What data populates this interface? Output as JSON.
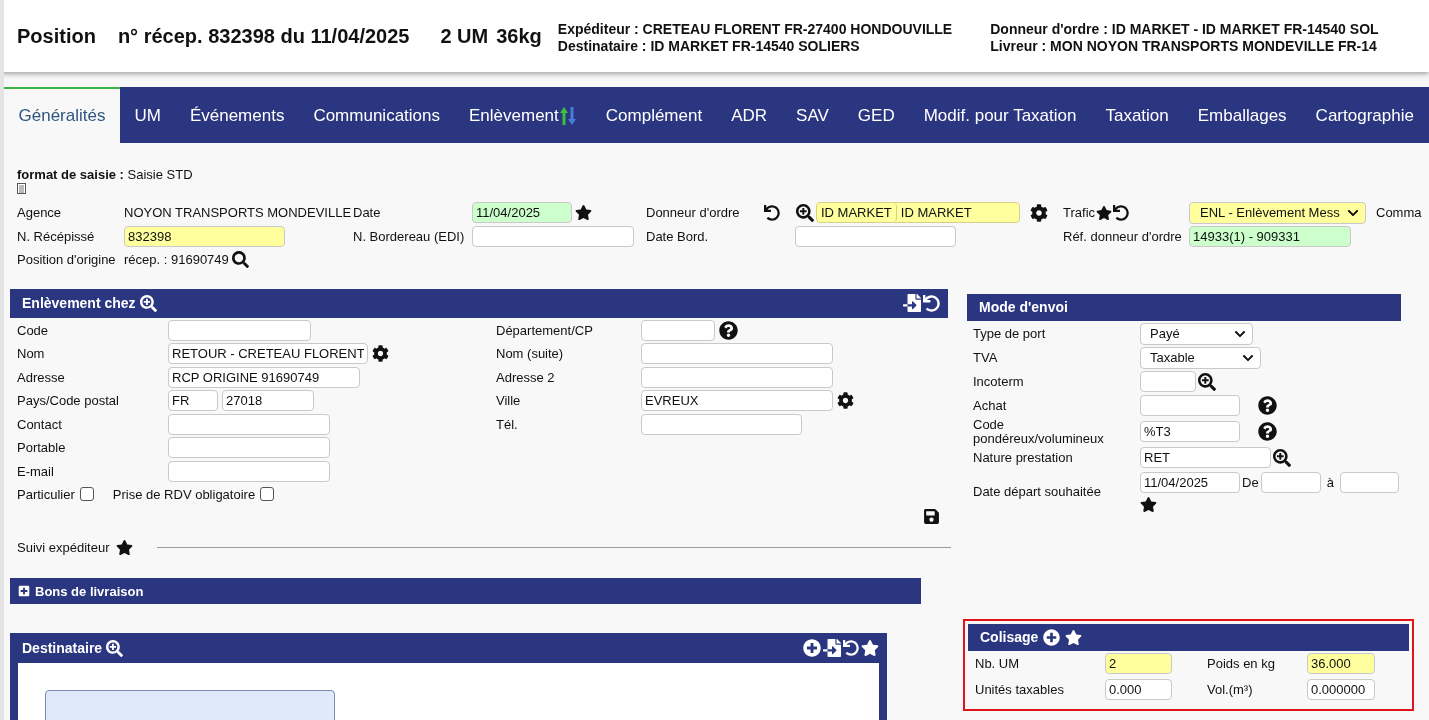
{
  "header": {
    "title": "Position",
    "receipt": "n° récep. 832398 du 11/04/2025",
    "units": "2 UM",
    "weight": "36kg",
    "parties": [
      "Expéditeur : CRETEAU FLORENT FR-27400 HONDOUVILLE",
      "Destinataire : ID MARKET FR-14540 SOLIERS"
    ],
    "parties_right": [
      "Donneur d'ordre : ID MARKET - ID MARKET FR-14540 SOL",
      "Livreur : MON NOYON TRANSPORTS MONDEVILLE FR-14"
    ]
  },
  "tabs": [
    {
      "label": "Généralités",
      "selected": true,
      "sort_icon": false
    },
    {
      "label": "UM",
      "selected": false,
      "sort_icon": false
    },
    {
      "label": "Événements",
      "selected": false,
      "sort_icon": false
    },
    {
      "label": "Communications",
      "selected": false,
      "sort_icon": false
    },
    {
      "label": "Enlèvement",
      "selected": false,
      "sort_icon": true
    },
    {
      "label": "Complément",
      "selected": false,
      "sort_icon": false
    },
    {
      "label": "ADR",
      "selected": false,
      "sort_icon": false
    },
    {
      "label": "SAV",
      "selected": false,
      "sort_icon": false
    },
    {
      "label": "GED",
      "selected": false,
      "sort_icon": false
    },
    {
      "label": "Modif. pour Taxation",
      "selected": false,
      "sort_icon": false
    },
    {
      "label": "Taxation",
      "selected": false,
      "sort_icon": false
    },
    {
      "label": "Emballages",
      "selected": false,
      "sort_icon": false
    },
    {
      "label": "Cartographie",
      "selected": false,
      "sort_icon": false
    }
  ],
  "general": {
    "format": {
      "label": "format de saisie :",
      "value": "Saisie STD"
    },
    "agence": {
      "label": "Agence",
      "value": "NOYON TRANSPORTS MONDEVILLE"
    },
    "date": {
      "label": "Date",
      "value": "11/04/2025",
      "validated": true
    },
    "donneur": {
      "label": "Donneur d'ordre",
      "code": "ID MARKET",
      "name": "ID MARKET",
      "required": true
    },
    "trafic": {
      "label": "Trafic",
      "value": "ENL - Enlèvement Mess",
      "required": true
    },
    "commande": {
      "label": "Comma"
    },
    "recepisse": {
      "label": "N. Récépissé",
      "value": "832398",
      "required": true
    },
    "bordereau": {
      "label": "N. Bordereau (EDI)"
    },
    "date_bord": {
      "label": "Date Bord."
    },
    "ref_donneur": {
      "label": "Réf. donneur d'ordre",
      "value": "14933(1) - 909331",
      "validated": true
    },
    "origine": {
      "label": "Position d'origine",
      "value": "récep. : 91690749"
    }
  },
  "pickup": {
    "title": "Enlèvement chez",
    "left": [
      {
        "label": "Code",
        "kind": "input"
      },
      {
        "label": "Nom",
        "kind": "input",
        "value": "RETOUR - CRETEAU FLORENT",
        "settings": true
      },
      {
        "label": "Adresse",
        "kind": "input",
        "value": "RCP ORIGINE 91690749"
      },
      {
        "label": "Pays/Code postal",
        "kind": "pair",
        "values": [
          "FR",
          "27018"
        ]
      },
      {
        "label": "Contact",
        "kind": "input"
      },
      {
        "label": "Portable",
        "kind": "input"
      },
      {
        "label": "E-mail",
        "kind": "input"
      }
    ],
    "right": [
      {
        "label": "Département/CP",
        "kind": "input",
        "help": true
      },
      {
        "label": "Nom (suite)",
        "kind": "input"
      },
      {
        "label": "Adresse 2",
        "kind": "input"
      },
      {
        "label": "Ville",
        "kind": "input",
        "value": "EVREUX",
        "settings": true
      },
      {
        "label": "Tél.",
        "kind": "input"
      }
    ],
    "checkboxes": [
      {
        "label": "Particulier",
        "checked": false
      },
      {
        "label": "Prise de RDV obligatoire",
        "checked": false
      }
    ],
    "follow": {
      "label": "Suivi expéditeur"
    }
  },
  "shipping": {
    "title": "Mode d'envoi",
    "rows": [
      {
        "label": "Type de port",
        "kind": "select",
        "value": "Payé"
      },
      {
        "label": "TVA",
        "kind": "select",
        "value": "Taxable"
      },
      {
        "label": "Incoterm",
        "kind": "input",
        "lookup": true
      },
      {
        "label": "Achat",
        "kind": "input",
        "help": true
      },
      {
        "label": "Code pondéreux/volumineux",
        "kind": "input",
        "value": "%T3",
        "help": true
      },
      {
        "label": "Nature prestation",
        "kind": "input",
        "value": "RET",
        "lookup": true
      },
      {
        "label": "Date départ souhaitée",
        "kind": "date_range",
        "value": "11/04/2025",
        "from_label": "De",
        "to_label": "à"
      }
    ]
  },
  "delivery_notes": {
    "title": "Bons de livraison"
  },
  "recipient": {
    "title": "Destinataire"
  },
  "packing": {
    "title": "Colisage",
    "fields": [
      {
        "label": "Nb. UM",
        "value": "2",
        "required": true
      },
      {
        "label": "Poids en kg",
        "value": "36.000",
        "required": true
      },
      {
        "label": "Unités taxables",
        "value": "0.000",
        "required": false
      },
      {
        "label": "Vol.(m³)",
        "value": "0.000000",
        "required": false
      }
    ]
  }
}
